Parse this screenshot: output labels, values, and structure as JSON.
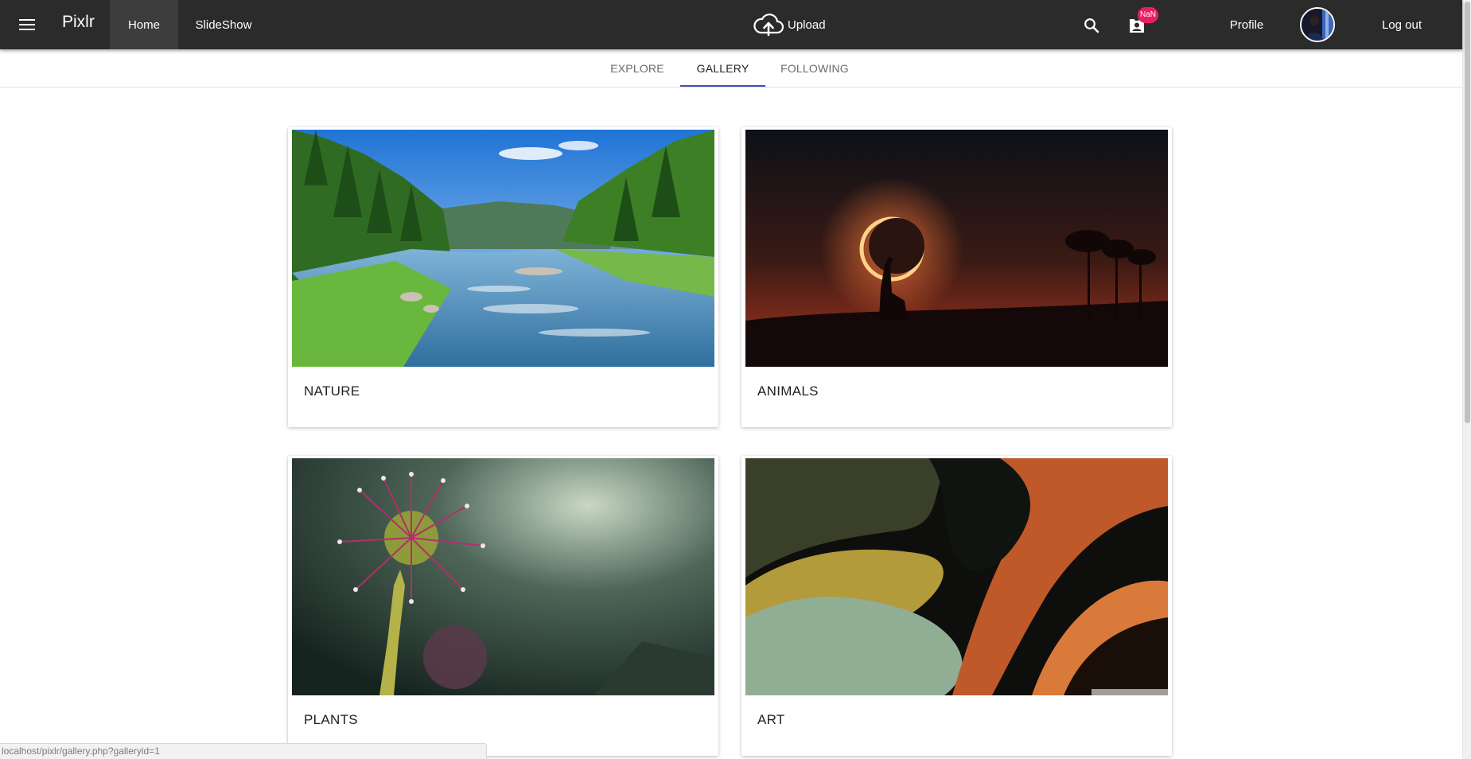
{
  "app": {
    "brand": "Pixlr"
  },
  "nav": {
    "home": "Home",
    "slideshow": "SlideShow",
    "upload": "Upload",
    "notification_badge": "NaN",
    "profile": "Profile",
    "logout": "Log out"
  },
  "tabs": {
    "explore": "EXPLORE",
    "gallery": "GALLERY",
    "following": "FOLLOWING",
    "active": "GALLERY"
  },
  "gallery": {
    "cards": [
      {
        "title": "NATURE",
        "image": "river-forest-landscape"
      },
      {
        "title": "ANIMALS",
        "image": "giraffe-eclipse-silhouette"
      },
      {
        "title": "PLANTS",
        "image": "sundew-plant-macro"
      },
      {
        "title": "ART",
        "image": "abstract-swirl-painting"
      }
    ]
  },
  "status_bar": {
    "url": "localhost/pixlr/gallery.php?galleryid=1"
  },
  "colors": {
    "appbar": "#2b2b2b",
    "appbar_active": "#3d3d3d",
    "tab_indicator": "#3f51b5",
    "badge": "#e91e63"
  },
  "icons": [
    "menu-icon",
    "cloud-upload-icon",
    "search-icon",
    "notification-icon",
    "avatar"
  ]
}
